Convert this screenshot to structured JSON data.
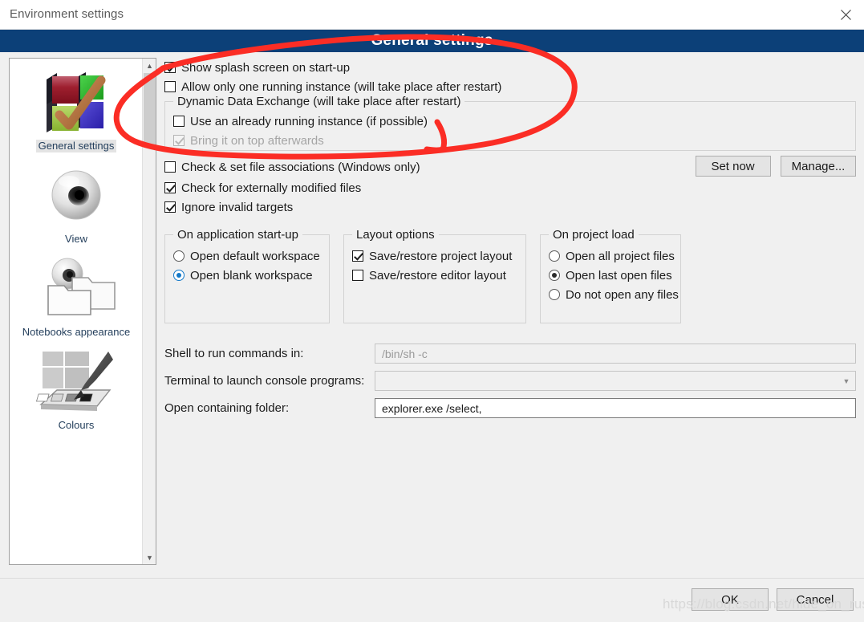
{
  "window": {
    "title": "Environment settings",
    "close_icon": "close-icon",
    "header_title": "General settings"
  },
  "sidebar": {
    "items": [
      {
        "label": "General settings",
        "icon": "coloured-cubes-check-icon",
        "selected": true
      },
      {
        "label": "View",
        "icon": "eye-icon",
        "selected": false
      },
      {
        "label": "Notebooks appearance",
        "icon": "folders-eye-icon",
        "selected": false
      },
      {
        "label": "Colours",
        "icon": "paint-palette-brush-icon",
        "selected": false
      }
    ],
    "scroll_up_icon": "chevron-up-icon",
    "scroll_down_icon": "chevron-down-icon"
  },
  "main": {
    "checkboxes": [
      {
        "label": "Show splash screen on start-up",
        "checked": true,
        "disabled": false
      },
      {
        "label": "Allow only one running instance (will take place after restart)",
        "checked": false,
        "disabled": false
      }
    ],
    "dde_group": {
      "title": "Dynamic Data Exchange (will take place after restart)",
      "checkboxes": [
        {
          "label": "Use an already running instance (if possible)",
          "checked": false,
          "disabled": false
        },
        {
          "label": "Bring it on top afterwards",
          "checked": true,
          "disabled": true
        }
      ]
    },
    "associations": {
      "label": "Check & set file associations (Windows only)",
      "checked": false,
      "set_now_label": "Set now",
      "manage_label": "Manage..."
    },
    "checkboxes2": [
      {
        "label": "Check for externally modified files",
        "checked": true,
        "disabled": false
      },
      {
        "label": "Ignore invalid targets",
        "checked": true,
        "disabled": false
      }
    ],
    "startup_group": {
      "title": "On application start-up",
      "options": [
        {
          "label": "Open default workspace",
          "selected": false
        },
        {
          "label": "Open blank workspace",
          "selected": true
        }
      ]
    },
    "layout_group": {
      "title": "Layout options",
      "options": [
        {
          "label": "Save/restore project layout",
          "checked": true
        },
        {
          "label": "Save/restore editor layout",
          "checked": false
        }
      ]
    },
    "project_group": {
      "title": "On project load",
      "options": [
        {
          "label": "Open all project files",
          "selected": false
        },
        {
          "label": "Open last open files",
          "selected": true
        },
        {
          "label": "Do not open any files",
          "selected": false
        }
      ]
    },
    "fields": [
      {
        "label": "Shell to run commands in:",
        "value": "/bin/sh -c",
        "type": "readonly-text"
      },
      {
        "label": "Terminal to launch console programs:",
        "value": "",
        "type": "combo"
      },
      {
        "label": "Open containing folder:",
        "value": "explorer.exe /select,",
        "type": "text"
      }
    ]
  },
  "footer": {
    "ok_label": "OK",
    "cancel_label": "Cancel"
  },
  "watermark": "https://blog.csdn.net/hide_on_rush",
  "colors": {
    "header_blue": "#0c4078",
    "accent_radio": "#1479c8",
    "annotation_red": "#fb2d25",
    "dialog_bg": "#f0f0f0"
  }
}
